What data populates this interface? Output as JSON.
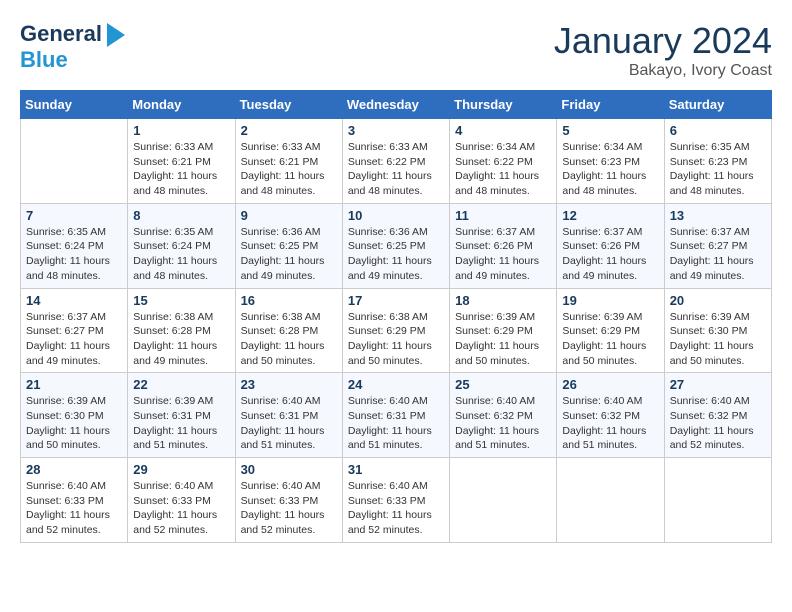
{
  "header": {
    "logo_line1": "General",
    "logo_line2": "Blue",
    "month": "January 2024",
    "location": "Bakayo, Ivory Coast"
  },
  "days_of_week": [
    "Sunday",
    "Monday",
    "Tuesday",
    "Wednesday",
    "Thursday",
    "Friday",
    "Saturday"
  ],
  "weeks": [
    [
      {
        "day": "",
        "sunrise": "",
        "sunset": "",
        "daylight": ""
      },
      {
        "day": "1",
        "sunrise": "Sunrise: 6:33 AM",
        "sunset": "Sunset: 6:21 PM",
        "daylight": "Daylight: 11 hours and 48 minutes."
      },
      {
        "day": "2",
        "sunrise": "Sunrise: 6:33 AM",
        "sunset": "Sunset: 6:21 PM",
        "daylight": "Daylight: 11 hours and 48 minutes."
      },
      {
        "day": "3",
        "sunrise": "Sunrise: 6:33 AM",
        "sunset": "Sunset: 6:22 PM",
        "daylight": "Daylight: 11 hours and 48 minutes."
      },
      {
        "day": "4",
        "sunrise": "Sunrise: 6:34 AM",
        "sunset": "Sunset: 6:22 PM",
        "daylight": "Daylight: 11 hours and 48 minutes."
      },
      {
        "day": "5",
        "sunrise": "Sunrise: 6:34 AM",
        "sunset": "Sunset: 6:23 PM",
        "daylight": "Daylight: 11 hours and 48 minutes."
      },
      {
        "day": "6",
        "sunrise": "Sunrise: 6:35 AM",
        "sunset": "Sunset: 6:23 PM",
        "daylight": "Daylight: 11 hours and 48 minutes."
      }
    ],
    [
      {
        "day": "7",
        "sunrise": "Sunrise: 6:35 AM",
        "sunset": "Sunset: 6:24 PM",
        "daylight": "Daylight: 11 hours and 48 minutes."
      },
      {
        "day": "8",
        "sunrise": "Sunrise: 6:35 AM",
        "sunset": "Sunset: 6:24 PM",
        "daylight": "Daylight: 11 hours and 48 minutes."
      },
      {
        "day": "9",
        "sunrise": "Sunrise: 6:36 AM",
        "sunset": "Sunset: 6:25 PM",
        "daylight": "Daylight: 11 hours and 49 minutes."
      },
      {
        "day": "10",
        "sunrise": "Sunrise: 6:36 AM",
        "sunset": "Sunset: 6:25 PM",
        "daylight": "Daylight: 11 hours and 49 minutes."
      },
      {
        "day": "11",
        "sunrise": "Sunrise: 6:37 AM",
        "sunset": "Sunset: 6:26 PM",
        "daylight": "Daylight: 11 hours and 49 minutes."
      },
      {
        "day": "12",
        "sunrise": "Sunrise: 6:37 AM",
        "sunset": "Sunset: 6:26 PM",
        "daylight": "Daylight: 11 hours and 49 minutes."
      },
      {
        "day": "13",
        "sunrise": "Sunrise: 6:37 AM",
        "sunset": "Sunset: 6:27 PM",
        "daylight": "Daylight: 11 hours and 49 minutes."
      }
    ],
    [
      {
        "day": "14",
        "sunrise": "Sunrise: 6:37 AM",
        "sunset": "Sunset: 6:27 PM",
        "daylight": "Daylight: 11 hours and 49 minutes."
      },
      {
        "day": "15",
        "sunrise": "Sunrise: 6:38 AM",
        "sunset": "Sunset: 6:28 PM",
        "daylight": "Daylight: 11 hours and 49 minutes."
      },
      {
        "day": "16",
        "sunrise": "Sunrise: 6:38 AM",
        "sunset": "Sunset: 6:28 PM",
        "daylight": "Daylight: 11 hours and 50 minutes."
      },
      {
        "day": "17",
        "sunrise": "Sunrise: 6:38 AM",
        "sunset": "Sunset: 6:29 PM",
        "daylight": "Daylight: 11 hours and 50 minutes."
      },
      {
        "day": "18",
        "sunrise": "Sunrise: 6:39 AM",
        "sunset": "Sunset: 6:29 PM",
        "daylight": "Daylight: 11 hours and 50 minutes."
      },
      {
        "day": "19",
        "sunrise": "Sunrise: 6:39 AM",
        "sunset": "Sunset: 6:29 PM",
        "daylight": "Daylight: 11 hours and 50 minutes."
      },
      {
        "day": "20",
        "sunrise": "Sunrise: 6:39 AM",
        "sunset": "Sunset: 6:30 PM",
        "daylight": "Daylight: 11 hours and 50 minutes."
      }
    ],
    [
      {
        "day": "21",
        "sunrise": "Sunrise: 6:39 AM",
        "sunset": "Sunset: 6:30 PM",
        "daylight": "Daylight: 11 hours and 50 minutes."
      },
      {
        "day": "22",
        "sunrise": "Sunrise: 6:39 AM",
        "sunset": "Sunset: 6:31 PM",
        "daylight": "Daylight: 11 hours and 51 minutes."
      },
      {
        "day": "23",
        "sunrise": "Sunrise: 6:40 AM",
        "sunset": "Sunset: 6:31 PM",
        "daylight": "Daylight: 11 hours and 51 minutes."
      },
      {
        "day": "24",
        "sunrise": "Sunrise: 6:40 AM",
        "sunset": "Sunset: 6:31 PM",
        "daylight": "Daylight: 11 hours and 51 minutes."
      },
      {
        "day": "25",
        "sunrise": "Sunrise: 6:40 AM",
        "sunset": "Sunset: 6:32 PM",
        "daylight": "Daylight: 11 hours and 51 minutes."
      },
      {
        "day": "26",
        "sunrise": "Sunrise: 6:40 AM",
        "sunset": "Sunset: 6:32 PM",
        "daylight": "Daylight: 11 hours and 51 minutes."
      },
      {
        "day": "27",
        "sunrise": "Sunrise: 6:40 AM",
        "sunset": "Sunset: 6:32 PM",
        "daylight": "Daylight: 11 hours and 52 minutes."
      }
    ],
    [
      {
        "day": "28",
        "sunrise": "Sunrise: 6:40 AM",
        "sunset": "Sunset: 6:33 PM",
        "daylight": "Daylight: 11 hours and 52 minutes."
      },
      {
        "day": "29",
        "sunrise": "Sunrise: 6:40 AM",
        "sunset": "Sunset: 6:33 PM",
        "daylight": "Daylight: 11 hours and 52 minutes."
      },
      {
        "day": "30",
        "sunrise": "Sunrise: 6:40 AM",
        "sunset": "Sunset: 6:33 PM",
        "daylight": "Daylight: 11 hours and 52 minutes."
      },
      {
        "day": "31",
        "sunrise": "Sunrise: 6:40 AM",
        "sunset": "Sunset: 6:33 PM",
        "daylight": "Daylight: 11 hours and 52 minutes."
      },
      {
        "day": "",
        "sunrise": "",
        "sunset": "",
        "daylight": ""
      },
      {
        "day": "",
        "sunrise": "",
        "sunset": "",
        "daylight": ""
      },
      {
        "day": "",
        "sunrise": "",
        "sunset": "",
        "daylight": ""
      }
    ]
  ]
}
